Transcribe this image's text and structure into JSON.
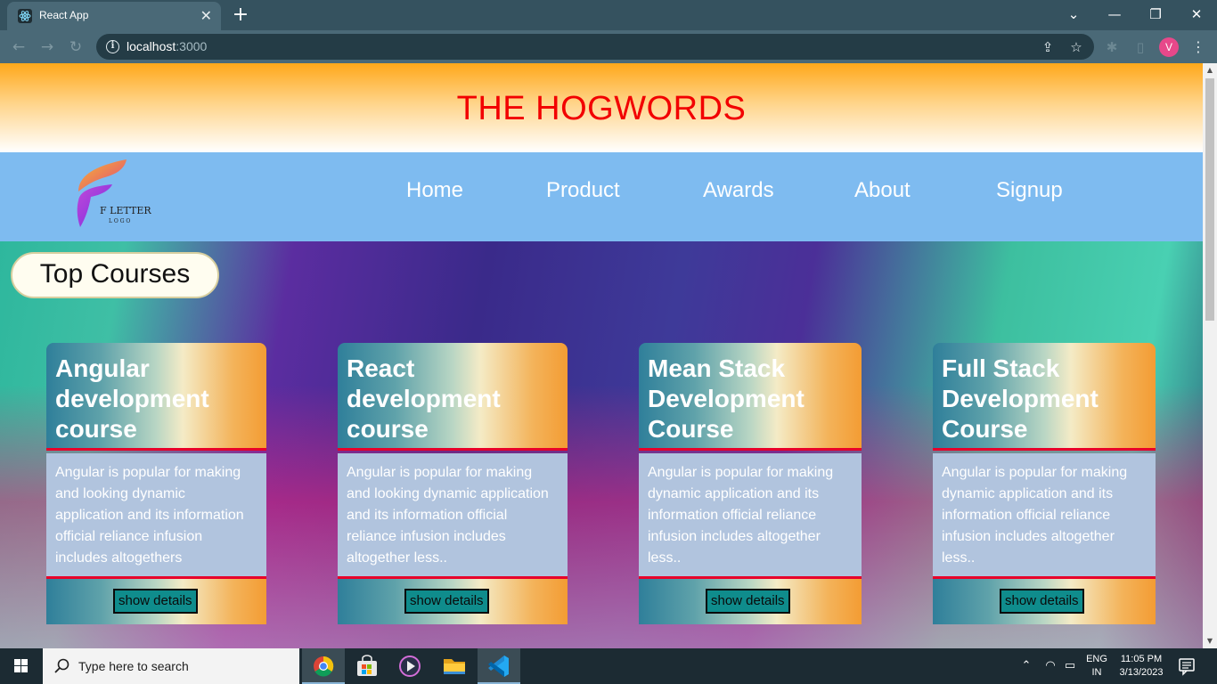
{
  "browser": {
    "tab_title": "React App",
    "tab_close": "✕",
    "new_tab": "+",
    "url_host": "localhost",
    "url_port": ":3000",
    "avatar_letter": "V",
    "window_controls": {
      "dropdown": "⌄",
      "minimize": "—",
      "restore": "❐",
      "close": "✕"
    }
  },
  "site": {
    "title": "THE HOGWORDS",
    "logo": {
      "letter": "F LETTER",
      "sub": "L O G O"
    },
    "nav": [
      "Home",
      "Product",
      "Awards",
      "About",
      "Signup"
    ],
    "section_title": "Top Courses"
  },
  "courses": [
    {
      "title": "Angular development course",
      "description": "Angular is popular for making and looking dynamic application and its information official reliance infusion includes altogethers",
      "button": "show details"
    },
    {
      "title": "React development course",
      "description": "Angular is popular for making and looking dynamic application and its information official reliance infusion includes altogether less..",
      "button": "show details"
    },
    {
      "title": "Mean Stack Development Course",
      "description": "Angular is popular for making dynamic application and its information official reliance infusion includes altogether less..",
      "button": "show details"
    },
    {
      "title": "Full Stack Development Course",
      "description": "Angular is popular for making dynamic application and its information official reliance infusion includes altogether less..",
      "button": "show details"
    }
  ],
  "taskbar": {
    "search_placeholder": "Type here to search",
    "lang_top": "ENG",
    "lang_bottom": "IN",
    "time": "11:05 PM",
    "date": "3/13/2023"
  },
  "colors": {
    "hero_title": "#f20000",
    "navbar": "#7ebbf0",
    "card_border": "#e8002a",
    "card_body": "#b1c4de",
    "button": "#0f8c8c"
  }
}
